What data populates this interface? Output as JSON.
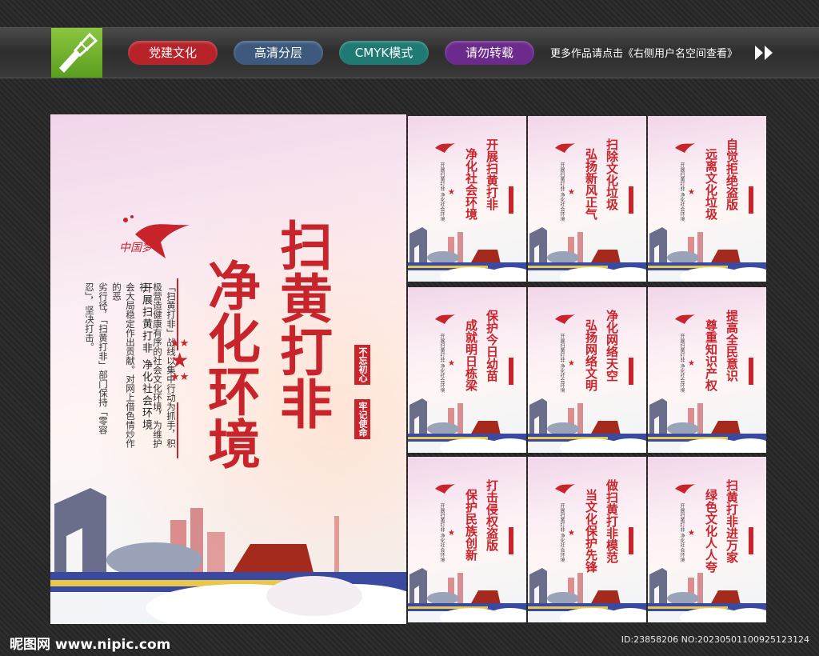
{
  "topbar": {
    "tags": [
      {
        "label": "党建文化",
        "color": "#b8232a"
      },
      {
        "label": "高清分层",
        "color": "#3d5a7e"
      },
      {
        "label": "CMYK模式",
        "color": "#1e7a72"
      },
      {
        "label": "请勿转载",
        "color": "#6b2a8c"
      }
    ],
    "note": "更多作品请点击《右侧用户名空间查看》"
  },
  "main": {
    "title_right": "扫黄打非",
    "title_left": "净化环境",
    "seal_top": "不忘初心",
    "seal_bottom": "牢记使命",
    "subtitle": "开展扫黄打非  净化社会环境",
    "body_lines": [
      "「扫黄打非」战线以集中行动为抓手，积",
      "极营造健康有序的社会文化环境，为维护社",
      "会大局稳定作出贡献。对网上借色情炒作的恶",
      "劣行径，「扫黄打非」部门保持「零容",
      "忍」，坚决打击。"
    ],
    "logo_text": "中国梦"
  },
  "small_posters": [
    {
      "line1": "开展扫黄打非",
      "line2": "净化社会环境"
    },
    {
      "line1": "扫除文化垃圾",
      "line2": "弘扬新风正气"
    },
    {
      "line1": "自觉拒绝盗版",
      "line2": "远离文化垃圾"
    },
    {
      "line1": "保护今日幼苗",
      "line2": "成就明日栋梁"
    },
    {
      "line1": "净化网络天空",
      "line2": "弘扬网络文明"
    },
    {
      "line1": "提高全民意识",
      "line2": "尊重知识产权"
    },
    {
      "line1": "打击侵权盗版",
      "line2": "保护民族创新"
    },
    {
      "line1": "做扫黄打非模范",
      "line2": "当文化保护先锋"
    },
    {
      "line1": "扫黄打非进万家",
      "line2": "绿色文化人人夸"
    }
  ],
  "small_tagline": "开展扫黄打非 净化社会环境",
  "footer": {
    "site": "昵图网 www.nipic.com",
    "id": "ID:23858206 NO:20230501100925123124"
  }
}
